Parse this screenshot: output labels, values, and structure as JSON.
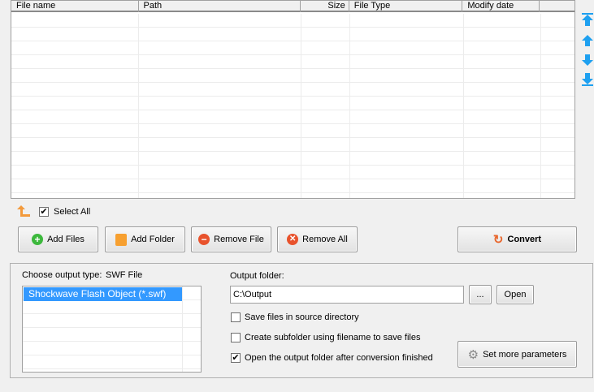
{
  "table": {
    "columns": [
      "File name",
      "Path",
      "Size",
      "File Type",
      "Modify date"
    ],
    "rows": []
  },
  "side_arrows": [
    "move-top",
    "move-up",
    "move-down",
    "move-bottom"
  ],
  "select_all": {
    "label": "Select All",
    "checked": true
  },
  "buttons": {
    "add_files": "Add Files",
    "add_folder": "Add Folder",
    "remove_file": "Remove File",
    "remove_all": "Remove All",
    "convert": "Convert",
    "browse": "...",
    "open": "Open",
    "more_params": "Set more parameters"
  },
  "output": {
    "type_label": "Choose output type:",
    "type_value": "SWF File",
    "formats": [
      "Shockwave Flash Object (*.swf)"
    ],
    "folder_label": "Output folder:",
    "folder_value": "C:\\Output"
  },
  "options": [
    {
      "label": "Save files in source directory",
      "checked": false
    },
    {
      "label": "Create subfolder using filename to save files",
      "checked": false
    },
    {
      "label": "Open the output folder after conversion finished",
      "checked": true
    }
  ],
  "colors": {
    "selection": "#3399ff",
    "arrow": "#1ea0f0"
  }
}
